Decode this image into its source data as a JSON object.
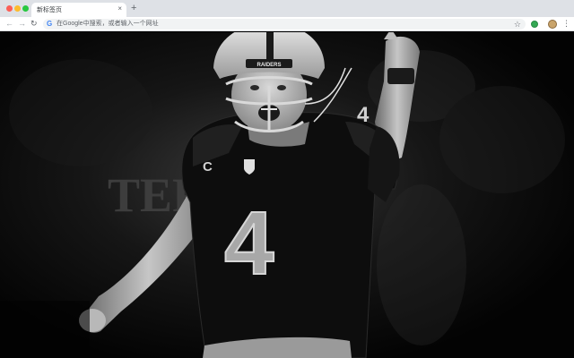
{
  "browser": {
    "tab": {
      "title": "新标签页",
      "close_glyph": "×"
    },
    "new_tab_glyph": "+",
    "nav": {
      "back_glyph": "←",
      "forward_glyph": "→",
      "reload_glyph": "↻"
    },
    "omnibox": {
      "placeholder": "在Google中搜索，或者输入一个网址",
      "search_icon": "google-g-icon"
    },
    "bookmark_glyph": "☆",
    "menu_glyph": "⋮"
  },
  "wallpaper": {
    "helmet_text": "RAIDERS",
    "jersey_number": "4",
    "sleeve_number": "4",
    "captain_patch": "C",
    "background_lettering": "TER"
  },
  "colors": {
    "chrome_bg": "#dee1e6",
    "toolbar_bg": "#ffffff",
    "page_bg": "#050505"
  }
}
